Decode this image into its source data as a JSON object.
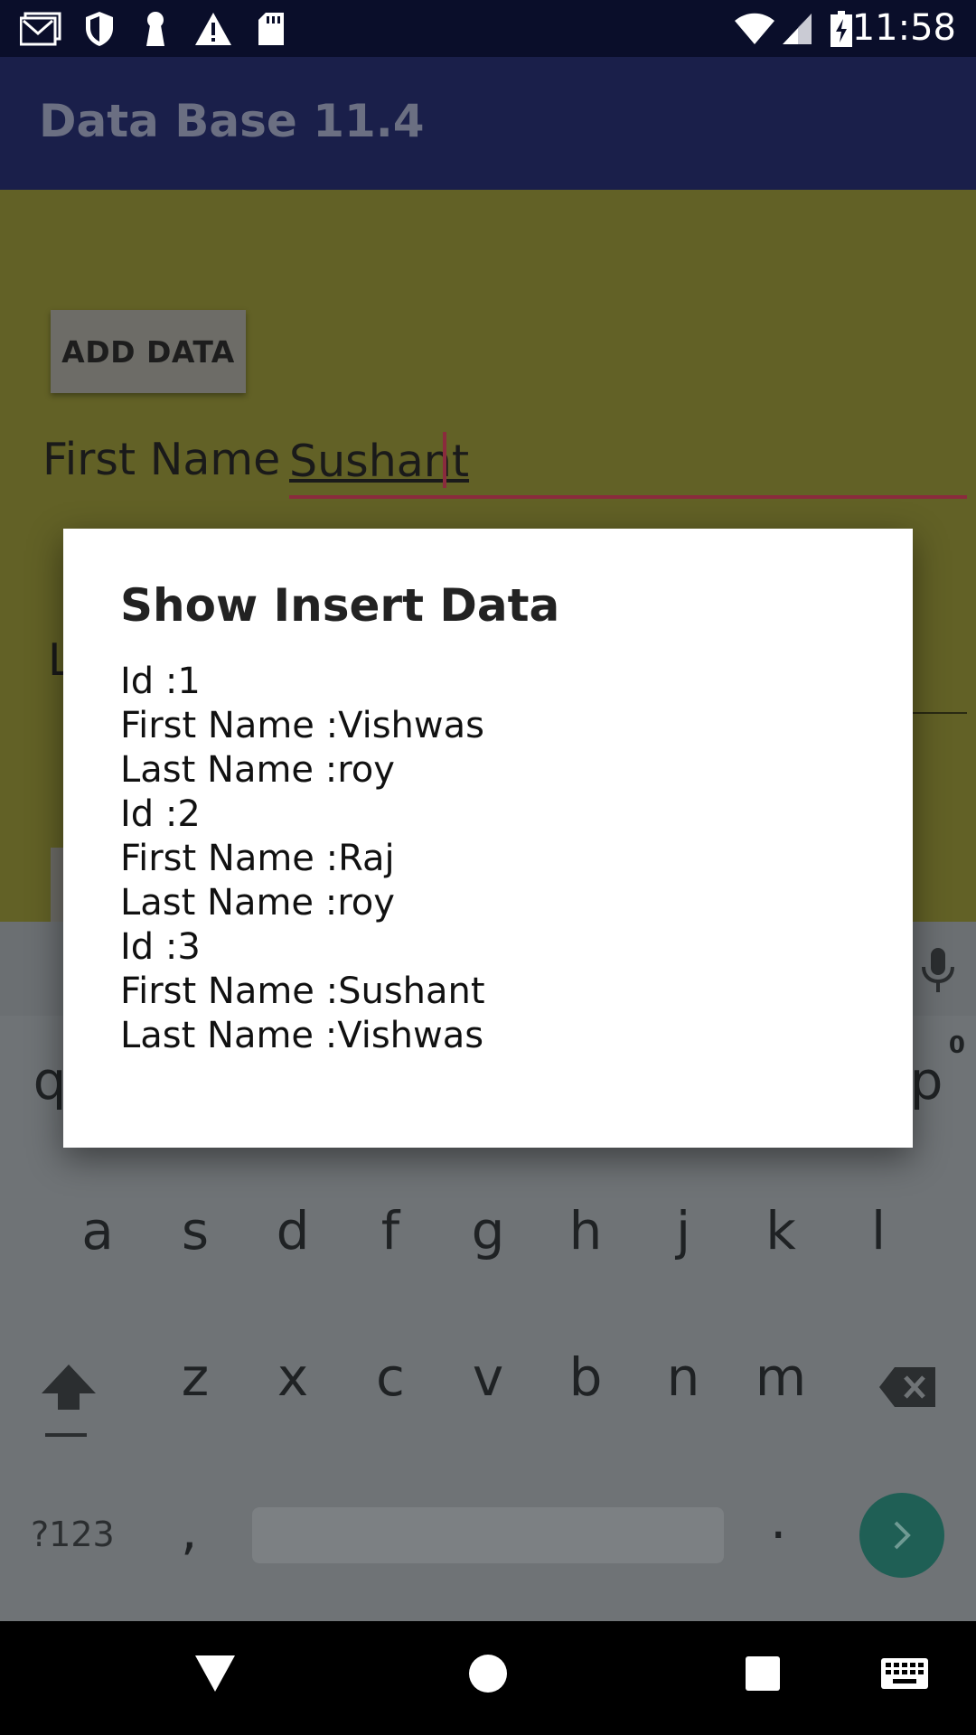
{
  "status_bar": {
    "time": "11:58",
    "icons": [
      "gmail-icon",
      "shield-icon",
      "keyhole-icon",
      "warning-icon",
      "sd-card-icon",
      "wifi-icon",
      "signal-icon",
      "battery-charging-icon"
    ]
  },
  "app_bar": {
    "title": "Data Base 11.4"
  },
  "form": {
    "add_button_label": "ADD DATA",
    "first_name_label": "First Name",
    "first_name_value": "Sushant",
    "last_name_label_partial": "L"
  },
  "dialog": {
    "title": "Show Insert Data",
    "lines": [
      "Id :1",
      "First Name :Vishwas",
      "Last Name :roy",
      "Id :2",
      "First Name :Raj",
      "Last Name :roy",
      "Id :3",
      "First Name :Sushant",
      "Last Name :Vishwas"
    ]
  },
  "keyboard": {
    "row1_visible": [
      "q",
      "p"
    ],
    "row1_hint": "0",
    "row2": [
      "a",
      "s",
      "d",
      "f",
      "g",
      "h",
      "j",
      "k",
      "l"
    ],
    "row3": [
      "z",
      "x",
      "c",
      "v",
      "b",
      "n",
      "m"
    ],
    "symbols_label": "?123",
    "comma": ",",
    "period": "."
  },
  "colors": {
    "status_bar": "#0a0e2a",
    "app_bar": "#1a1f4a",
    "content_bg": "#626126",
    "accent": "#8a2b3d",
    "enter_key": "#1f5f55"
  }
}
